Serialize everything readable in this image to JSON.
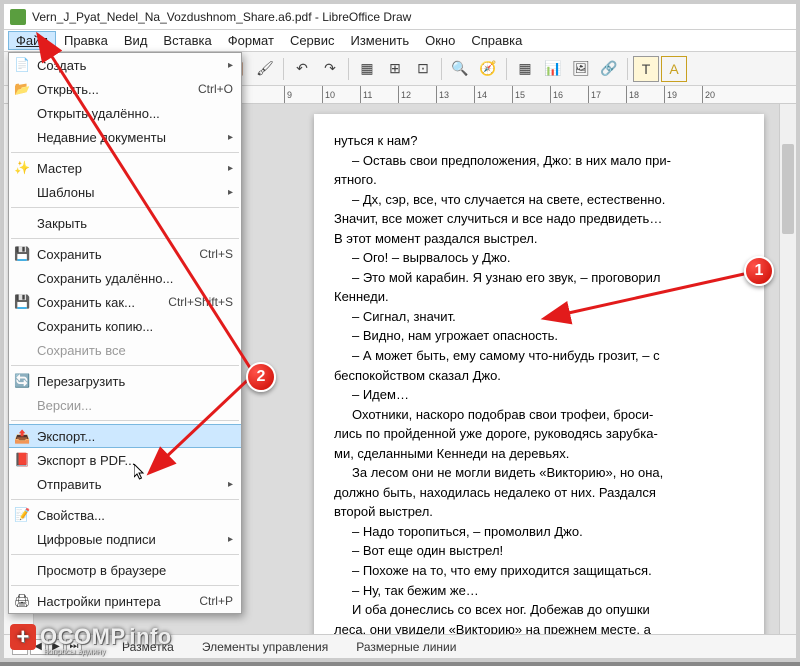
{
  "title": "Vern_J_Pyat_Nedel_Na_Vozdushnom_Share.a6.pdf - LibreOffice Draw",
  "menubar": {
    "file": "Файл",
    "edit": "Правка",
    "view": "Вид",
    "insert": "Вставка",
    "format": "Формат",
    "service": "Сервис",
    "modify": "Изменить",
    "window": "Окно",
    "help": "Справка"
  },
  "dropdown": {
    "create": "Создать",
    "open": "Открыть...",
    "open_shortcut": "Ctrl+O",
    "open_remote": "Открыть удалённо...",
    "recent": "Недавние документы",
    "wizard": "Мастер",
    "templates": "Шаблоны",
    "close": "Закрыть",
    "save": "Сохранить",
    "save_shortcut": "Ctrl+S",
    "save_remote": "Сохранить удалённо...",
    "save_as": "Сохранить как...",
    "save_as_shortcut": "Ctrl+Shift+S",
    "save_copy": "Сохранить копию...",
    "save_all": "Сохранить все",
    "reload": "Перезагрузить",
    "versions": "Версии...",
    "export": "Экспорт...",
    "export_pdf": "Экспорт в PDF...",
    "send": "Отправить",
    "properties": "Свойства...",
    "digital_sign": "Цифровые подписи",
    "preview_browser": "Просмотр в браузере",
    "print_settings": "Настройки принтера",
    "print_settings_shortcut": "Ctrl+P"
  },
  "ruler": [
    "9",
    "10",
    "11",
    "12",
    "13",
    "14",
    "15",
    "16",
    "17",
    "18",
    "19",
    "20"
  ],
  "document": {
    "lines": [
      "нуться к нам?",
      "– Оставь свои предположения, Джо: в них мало при-",
      "ятного.",
      "– Дх, сэр, все, что случается на свете, естественно.",
      "Значит, все может случиться и все надо предвидеть…",
      "В этот момент раздался выстрел.",
      "– Ого! – вырвалось у Джо.",
      "– Это мой карабин. Я узнаю его звук, – проговорил",
      "Кеннеди.",
      "– Сигнал, значит.",
      "– Видно, нам угрожает опасность.",
      "– А может быть, ему самому что-нибудь грозит, – с",
      "беспокойством сказал Джо.",
      "– Идем…",
      "Охотники, наскоро подобрав свои трофеи, броси-",
      "лись по пройденной уже дороге, руководясь зарубка-",
      "ми, сделанными Кеннеди на деревьях.",
      "За лесом они не могли видеть «Викторию», но она,",
      "должно быть, находилась недалеко от них. Раздался",
      "второй выстрел.",
      "– Надо торопиться, – промолвил Джо.",
      "– Вот еще один выстрел!",
      "– Похоже на то, что ему приходится защищаться.",
      "– Ну, так бежим же…",
      "И оба донеслись со всех ног. Добежав до опушки",
      "леса, они увидели «Викторию» на прежнем месте, а"
    ]
  },
  "status_tabs": {
    "layout": "Разметка",
    "controls": "Элементы управления",
    "dim_lines": "Размерные линии"
  },
  "callouts": {
    "c1": "1",
    "c2": "2"
  },
  "watermark": {
    "text": "OCOMP.info",
    "sub": "вопросы админу"
  }
}
